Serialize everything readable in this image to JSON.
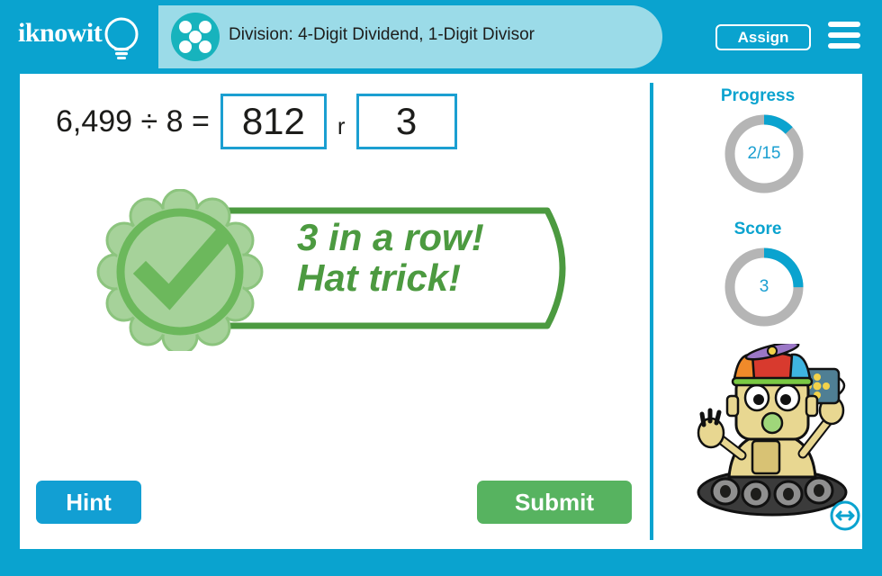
{
  "header": {
    "logo_text": "iknowit",
    "logo_icon": "lightbulb-icon",
    "lesson_icon": "five-dots-icon",
    "title": "Division: 4-Digit Dividend, 1-Digit Divisor",
    "assign_label": "Assign",
    "menu_icon": "hamburger-menu-icon",
    "bar_color": "#0aa3cf",
    "pill_color": "#9bdbe8",
    "dots_circle_color": "#17b3bd"
  },
  "question": {
    "prompt": "6,499 ÷ 8 =",
    "quotient_value": "812",
    "quotient_placeholder": "",
    "remainder_label": "r",
    "remainder_value": "3",
    "remainder_placeholder": "",
    "box_border_color": "#1b9fd1"
  },
  "feedback": {
    "line1": "3 in a row!",
    "line2": "Hat trick!",
    "badge_icon": "check-rosette-icon",
    "color": "#4c9a40",
    "badge_fill": "#a6d29a",
    "badge_ring": "#6cb85c"
  },
  "actions": {
    "hint_label": "Hint",
    "hint_color": "#129fd3",
    "submit_label": "Submit",
    "submit_color": "#57b360"
  },
  "sidebar": {
    "progress_label": "Progress",
    "progress_value": "2/15",
    "progress_percent": 13,
    "score_label": "Score",
    "score_value": "3",
    "score_percent": 25,
    "ring_track_color": "#b5b5b5",
    "ring_fill_color": "#0aa3cf",
    "mascot_icon": "robot-mascot-icon",
    "resize_icon": "resize-horizontal-icon"
  }
}
